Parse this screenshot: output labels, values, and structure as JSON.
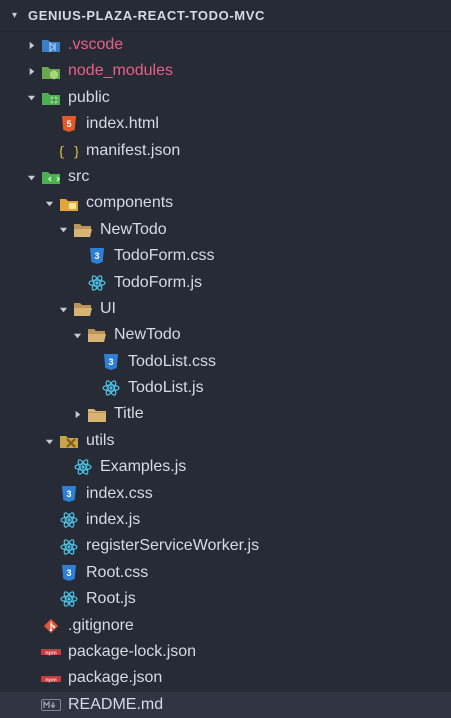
{
  "explorer": {
    "root_label": "GENIUS-PLAZA-REACT-TODO-MVC",
    "items": [
      {
        "label": ".vscode",
        "type": "folder-special",
        "icon": "vscode-folder-icon",
        "expanded": false,
        "ignored": true
      },
      {
        "label": "node_modules",
        "type": "folder-special",
        "icon": "node-folder-icon",
        "expanded": false,
        "ignored": true
      },
      {
        "label": "public",
        "type": "folder-special",
        "icon": "public-folder-icon",
        "expanded": true
      },
      {
        "label": "index.html",
        "type": "file",
        "icon": "html-file-icon"
      },
      {
        "label": "manifest.json",
        "type": "file",
        "icon": "json-file-icon"
      },
      {
        "label": "src",
        "type": "folder-special",
        "icon": "src-folder-icon",
        "expanded": true
      },
      {
        "label": "components",
        "type": "folder-special",
        "icon": "components-folder-icon",
        "expanded": true
      },
      {
        "label": "NewTodo",
        "type": "folder",
        "icon": "folder-open-icon",
        "expanded": true
      },
      {
        "label": "TodoForm.css",
        "type": "file",
        "icon": "css-file-icon"
      },
      {
        "label": "TodoForm.js",
        "type": "file",
        "icon": "react-file-icon"
      },
      {
        "label": "UI",
        "type": "folder",
        "icon": "folder-open-icon",
        "expanded": true
      },
      {
        "label": "NewTodo",
        "type": "folder",
        "icon": "folder-open-icon",
        "expanded": true
      },
      {
        "label": "TodoList.css",
        "type": "file",
        "icon": "css-file-icon"
      },
      {
        "label": "TodoList.js",
        "type": "file",
        "icon": "react-file-icon"
      },
      {
        "label": "Title",
        "type": "folder",
        "icon": "folder-closed-icon",
        "expanded": false
      },
      {
        "label": "utils",
        "type": "folder-special",
        "icon": "utils-folder-icon",
        "expanded": true
      },
      {
        "label": "Examples.js",
        "type": "file",
        "icon": "react-file-icon"
      },
      {
        "label": "index.css",
        "type": "file",
        "icon": "css-file-icon"
      },
      {
        "label": "index.js",
        "type": "file",
        "icon": "react-file-icon"
      },
      {
        "label": "registerServiceWorker.js",
        "type": "file",
        "icon": "react-file-icon"
      },
      {
        "label": "Root.css",
        "type": "file",
        "icon": "css-file-icon"
      },
      {
        "label": "Root.js",
        "type": "file",
        "icon": "react-file-icon"
      },
      {
        "label": ".gitignore",
        "type": "file",
        "icon": "git-file-icon"
      },
      {
        "label": "package-lock.json",
        "type": "file",
        "icon": "npm-file-icon"
      },
      {
        "label": "package.json",
        "type": "file",
        "icon": "npm-file-icon"
      },
      {
        "label": "README.md",
        "type": "file",
        "icon": "markdown-file-icon",
        "selected": true
      }
    ]
  },
  "colors": {
    "background": "#262b35",
    "text": "#d6dbe4",
    "ignored_text": "#e8608a",
    "selected_row": "#2f3542",
    "css_blue": "#2f7fd6",
    "react_cyan": "#4fc3e8",
    "html_orange": "#e45a26",
    "folder_tan": "#d7b474",
    "special_green": "#4caf50",
    "json_yellow": "#e8c440",
    "git_orange": "#e2533a",
    "npm_red": "#c43c3c"
  }
}
